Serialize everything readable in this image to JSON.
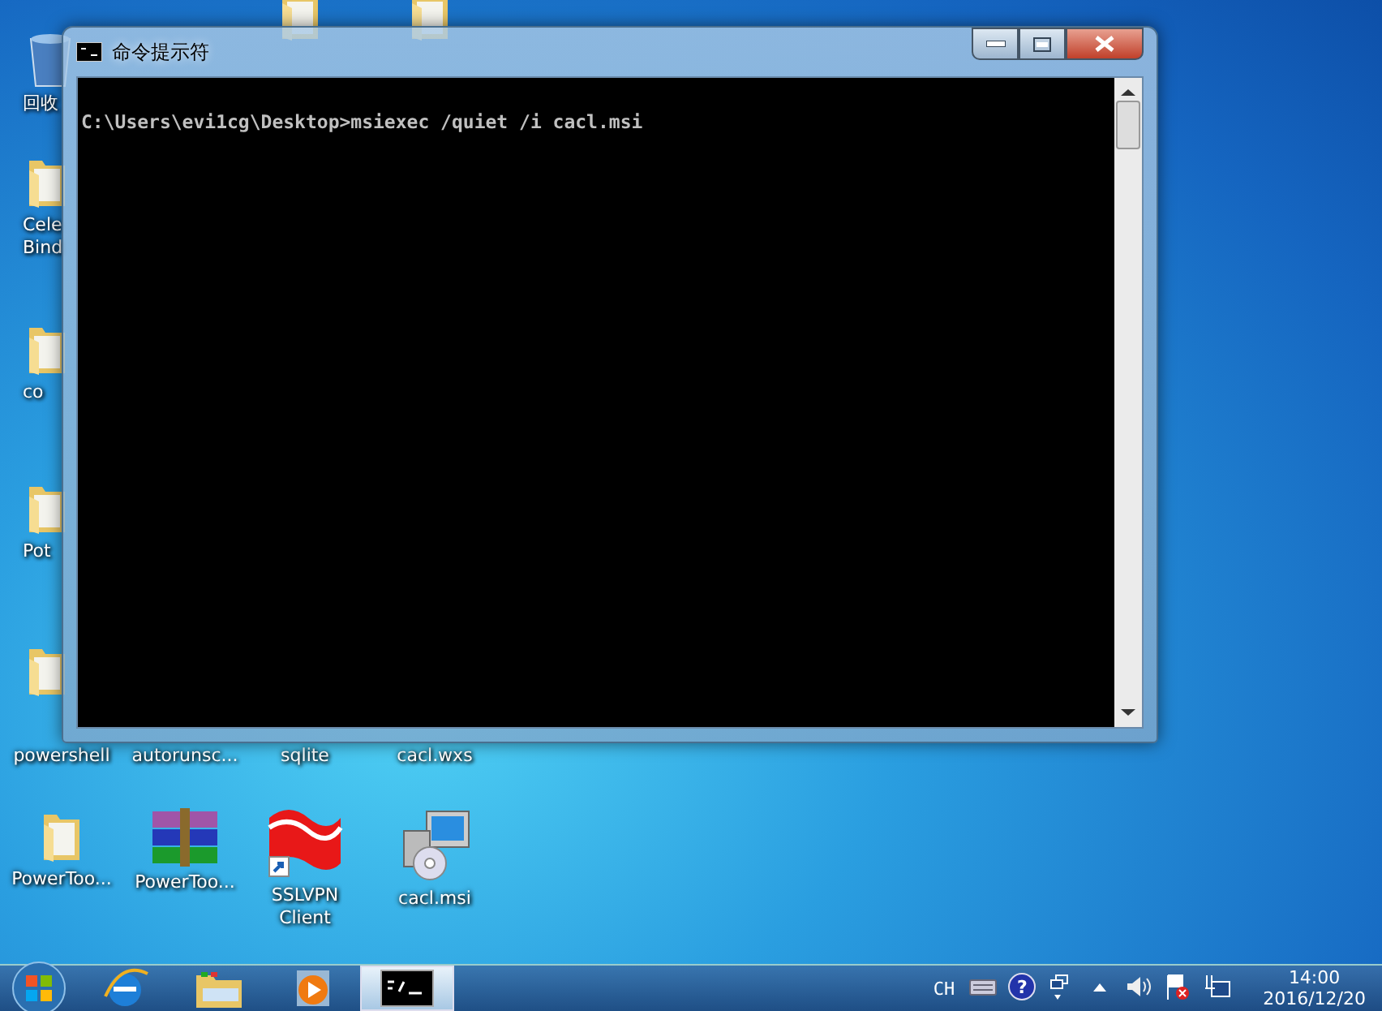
{
  "desktop": {
    "top_icons": [
      {
        "kind": "folder"
      },
      {
        "kind": "folder"
      }
    ],
    "left_column": [
      {
        "kind": "recycle",
        "label": "回收"
      },
      {
        "kind": "folder",
        "label": "Cele Bind"
      },
      {
        "kind": "folder",
        "label": "co"
      },
      {
        "kind": "folder",
        "label": "Pot"
      },
      {
        "kind": "folder"
      }
    ],
    "labels_below_window": [
      "powershell",
      "autorunsc...",
      "sqlite",
      "cacl.wxs"
    ],
    "bottom_row": [
      {
        "kind": "folder",
        "label": "PowerToo..."
      },
      {
        "kind": "winrar",
        "label": "PowerToo..."
      },
      {
        "kind": "vpn",
        "label": "SSLVPN Client"
      },
      {
        "kind": "installer",
        "label": "cacl.msi"
      }
    ]
  },
  "window": {
    "title": "命令提示符",
    "lines": [
      "C:\\Users\\evi1cg\\Desktop>msiexec /quiet /i cacl.msi"
    ]
  },
  "taskbar": {
    "items": [
      {
        "kind": "start",
        "selected": false
      },
      {
        "kind": "ie",
        "selected": false
      },
      {
        "kind": "explorer",
        "selected": false
      },
      {
        "kind": "media",
        "selected": false
      },
      {
        "kind": "cmd",
        "selected": true
      }
    ],
    "tray": {
      "language": "CH",
      "icons": [
        {
          "kind": "keyboard"
        },
        {
          "kind": "help",
          "glyph": "?"
        },
        {
          "kind": "display"
        },
        {
          "kind": "arrow"
        },
        {
          "kind": "speaker"
        },
        {
          "kind": "flag"
        },
        {
          "kind": "network"
        }
      ],
      "time": "14:00",
      "date": "2016/12/20"
    }
  }
}
